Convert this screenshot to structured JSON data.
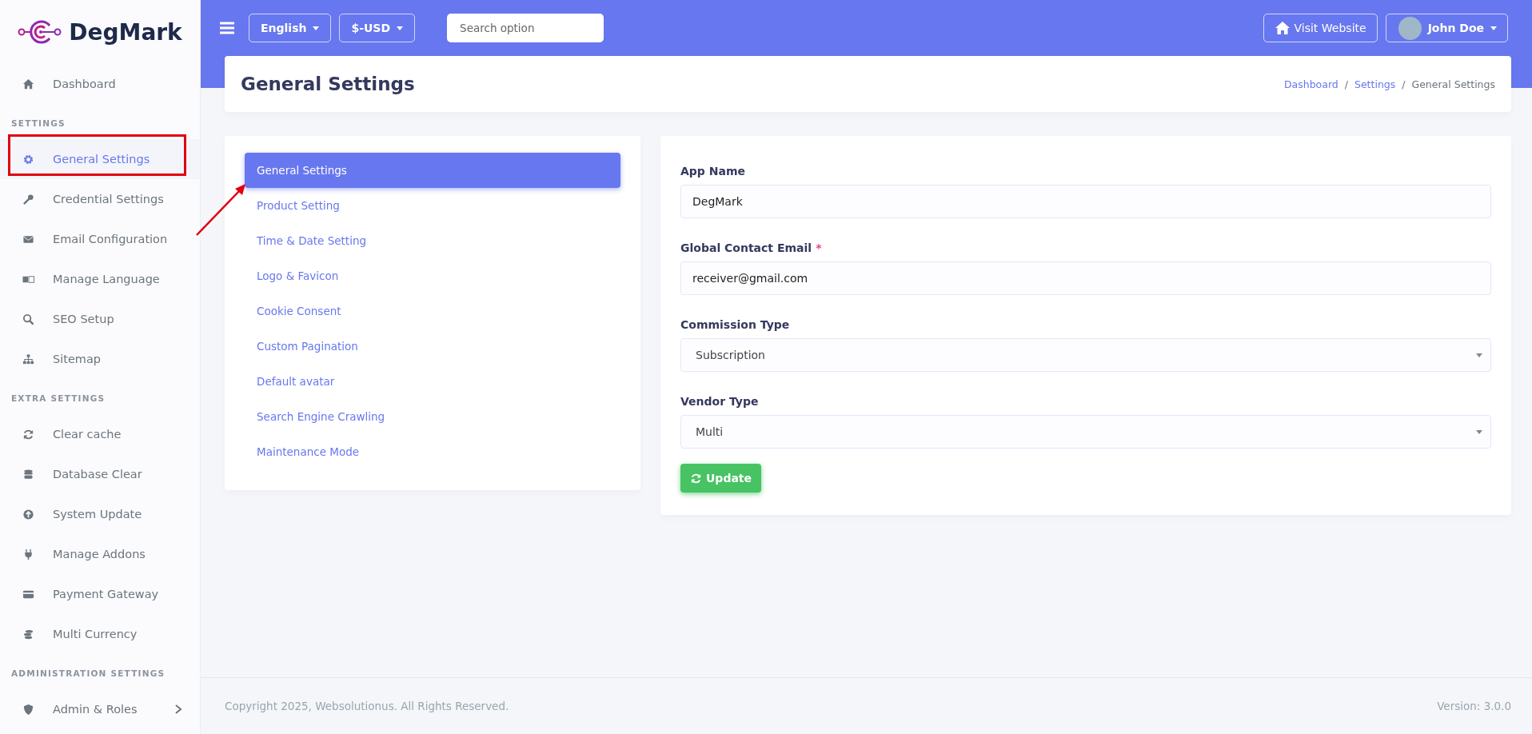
{
  "brand": {
    "name": "DegMark"
  },
  "sidebar": {
    "items": [
      {
        "kind": "item",
        "label": "Dashboard",
        "selected": false
      },
      {
        "kind": "heading",
        "label": "SETTINGS"
      },
      {
        "kind": "item",
        "label": "General Settings",
        "selected": true
      },
      {
        "kind": "item",
        "label": "Credential Settings",
        "selected": false
      },
      {
        "kind": "item",
        "label": "Email Configuration",
        "selected": false
      },
      {
        "kind": "item",
        "label": "Manage Language",
        "selected": false
      },
      {
        "kind": "item",
        "label": "SEO Setup",
        "selected": false
      },
      {
        "kind": "item",
        "label": "Sitemap",
        "selected": false
      },
      {
        "kind": "heading",
        "label": "EXTRA SETTINGS"
      },
      {
        "kind": "item",
        "label": "Clear cache",
        "selected": false
      },
      {
        "kind": "item",
        "label": "Database Clear",
        "selected": false
      },
      {
        "kind": "item",
        "label": "System Update",
        "selected": false
      },
      {
        "kind": "item",
        "label": "Manage Addons",
        "selected": false
      },
      {
        "kind": "item",
        "label": "Payment Gateway",
        "selected": false
      },
      {
        "kind": "item",
        "label": "Multi Currency",
        "selected": false
      },
      {
        "kind": "heading",
        "label": "ADMINISTRATION SETTINGS"
      },
      {
        "kind": "item",
        "label": "Admin & Roles",
        "selected": false,
        "submenu": true
      }
    ]
  },
  "topbar": {
    "language": "English",
    "currency": "$-USD",
    "search": {
      "placeholder": "Search option"
    },
    "visit_button": "Visit Website",
    "user": "John Doe"
  },
  "page_header": {
    "title": "General Settings",
    "breadcrumb": [
      {
        "label": "Dashboard",
        "link": true
      },
      {
        "label": "Settings",
        "link": true
      },
      {
        "label": "General Settings",
        "link": false
      }
    ],
    "separator": "/"
  },
  "settings_tabs": [
    {
      "label": "General Settings",
      "selected": true
    },
    {
      "label": "Product Setting",
      "selected": false
    },
    {
      "label": "Time & Date Setting",
      "selected": false
    },
    {
      "label": "Logo & Favicon",
      "selected": false
    },
    {
      "label": "Cookie Consent",
      "selected": false
    },
    {
      "label": "Custom Pagination",
      "selected": false
    },
    {
      "label": "Default avatar",
      "selected": false
    },
    {
      "label": "Search Engine Crawling",
      "selected": false
    },
    {
      "label": "Maintenance Mode",
      "selected": false
    }
  ],
  "form": {
    "fields": [
      {
        "kind": "text",
        "label": "App Name",
        "value": "DegMark"
      },
      {
        "kind": "text",
        "label": "Global Contact Email",
        "value": "receiver@gmail.com",
        "required_mark": "*"
      },
      {
        "kind": "select",
        "label": "Commission Type",
        "value": "Subscription"
      },
      {
        "kind": "select",
        "label": "Vendor Type",
        "value": "Multi"
      }
    ],
    "submit": "Update"
  },
  "footer": {
    "copyright": "Copyright 2025, Websolutionus. All Rights Reserved.",
    "version": "Version: 3.0.0"
  }
}
